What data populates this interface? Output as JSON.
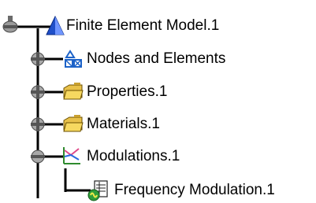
{
  "tree": {
    "root": {
      "label": "Finite Element Model.1",
      "icon": "finite-element-model-icon"
    },
    "children": [
      {
        "label": "Nodes and Elements",
        "icon": "nodes-elements-icon",
        "expandable": true
      },
      {
        "label": "Properties.1",
        "icon": "folder-icon",
        "expandable": true
      },
      {
        "label": "Materials.1",
        "icon": "folder-icon",
        "expandable": true
      },
      {
        "label": "Modulations.1",
        "icon": "modulation-icon",
        "expandable": true,
        "expanded": true,
        "children": [
          {
            "label": "Frequency Modulation.1",
            "icon": "frequency-modulation-icon"
          }
        ]
      }
    ]
  }
}
